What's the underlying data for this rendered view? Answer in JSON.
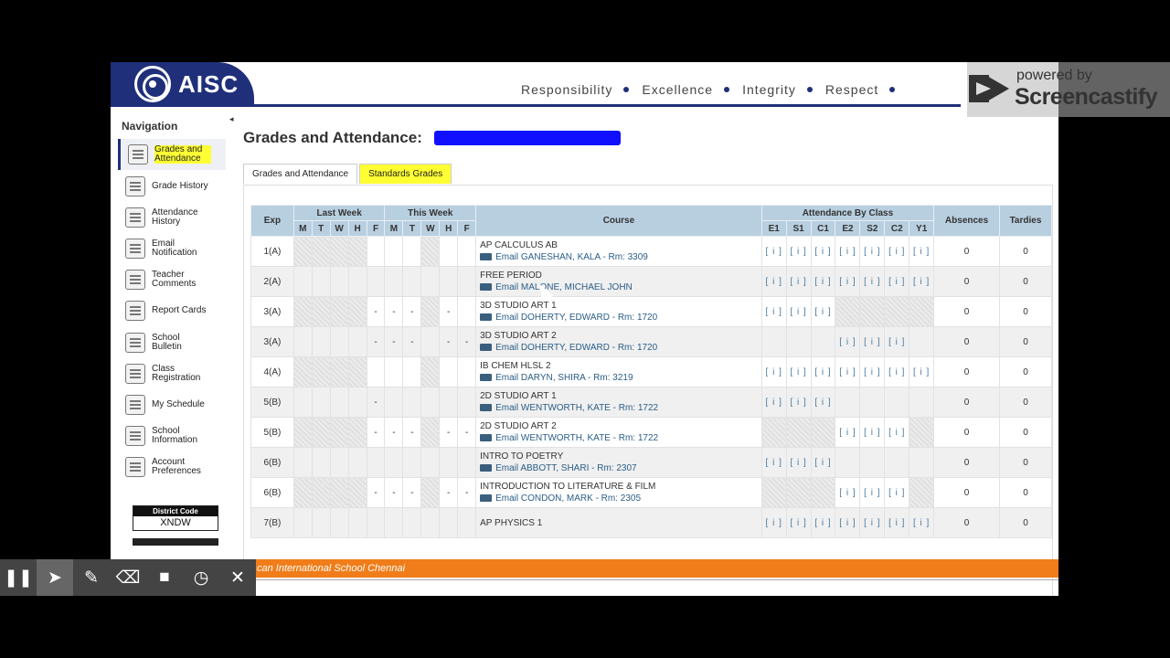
{
  "header": {
    "logo_text": "AISC",
    "values": [
      "Responsibility",
      "Excellence",
      "Integrity",
      "Respect"
    ]
  },
  "screencastify": {
    "powered": "powered by",
    "name": "Screencastify"
  },
  "sidebar": {
    "title": "Navigation",
    "items": [
      {
        "label": "Grades and Attendance",
        "icon": "gradebook-icon",
        "active": true
      },
      {
        "label": "Grade History",
        "icon": "history-icon"
      },
      {
        "label": "Attendance History",
        "icon": "attendance-icon"
      },
      {
        "label": "Email Notification",
        "icon": "envelope-icon"
      },
      {
        "label": "Teacher Comments",
        "icon": "comment-icon"
      },
      {
        "label": "Report Cards",
        "icon": "report-icon"
      },
      {
        "label": "School Bulletin",
        "icon": "bulletin-icon"
      },
      {
        "label": "Class Registration",
        "icon": "registration-icon"
      },
      {
        "label": "My Schedule",
        "icon": "schedule-icon"
      },
      {
        "label": "School Information",
        "icon": "school-icon"
      },
      {
        "label": "Account Preferences",
        "icon": "preferences-icon"
      }
    ],
    "district_label": "District Code",
    "district_code": "XNDW"
  },
  "main": {
    "title": "Grades and Attendance:",
    "tabs": [
      {
        "label": "Grades and Attendance",
        "active": true
      },
      {
        "label": "Standards Grades",
        "highlighted": true
      }
    ]
  },
  "table": {
    "caption": "Attendance By Class",
    "col_exp": "Exp",
    "last_week": "Last Week",
    "this_week": "This Week",
    "days": [
      "M",
      "T",
      "W",
      "H",
      "F"
    ],
    "col_course": "Course",
    "terms": [
      "E1",
      "S1",
      "C1",
      "E2",
      "S2",
      "C2",
      "Y1"
    ],
    "col_absences": "Absences",
    "col_tardies": "Tardies",
    "rows": [
      {
        "exp": "1(A)",
        "course": "AP CALCULUS AB",
        "teacher": "Email GANESHAN, KALA - Rm: 3309",
        "terms": [
          "[ i ]",
          "[ i ]",
          "[ i ]",
          "[ i ]",
          "[ i ]",
          "[ i ]",
          "[ i ]"
        ],
        "lw": [
          "",
          "",
          "",
          "",
          ""
        ],
        "tw": [
          "",
          "",
          "",
          "",
          ""
        ],
        "absences": "0",
        "tardies": "0"
      },
      {
        "exp": "2(A)",
        "course": "FREE PERIOD",
        "teacher": "Email MALONE, MICHAEL JOHN",
        "terms": [
          "[ i ]",
          "[ i ]",
          "[ i ]",
          "[ i ]",
          "[ i ]",
          "[ i ]",
          "[ i ]"
        ],
        "lw": [
          "",
          "",
          "",
          "",
          ""
        ],
        "tw": [
          "",
          "",
          "",
          "",
          ""
        ],
        "absences": "0",
        "tardies": "0"
      },
      {
        "exp": "3(A)",
        "course": "3D STUDIO ART 1",
        "teacher": "Email DOHERTY, EDWARD - Rm: 1720",
        "terms": [
          "[ i ]",
          "[ i ]",
          "[ i ]",
          "",
          "",
          "",
          ""
        ],
        "lw": [
          "",
          "",
          "",
          "",
          "-"
        ],
        "tw": [
          "-",
          "-",
          "",
          "-",
          ""
        ],
        "absences": "0",
        "tardies": "0"
      },
      {
        "exp": "3(A)",
        "course": "3D STUDIO ART 2",
        "teacher": "Email DOHERTY, EDWARD - Rm: 1720",
        "terms": [
          "",
          "",
          "",
          "[ i ]",
          "[ i ]",
          "[ i ]",
          ""
        ],
        "lw": [
          "",
          "",
          "",
          "",
          "-"
        ],
        "tw": [
          "-",
          "-",
          "",
          "-",
          "-"
        ],
        "absences": "0",
        "tardies": "0"
      },
      {
        "exp": "4(A)",
        "course": "IB CHEM HLSL 2",
        "teacher": "Email DARYN, SHIRA - Rm: 3219",
        "terms": [
          "[ i ]",
          "[ i ]",
          "[ i ]",
          "[ i ]",
          "[ i ]",
          "[ i ]",
          "[ i ]"
        ],
        "lw": [
          "",
          "",
          "",
          "",
          ""
        ],
        "tw": [
          "",
          "",
          "",
          "",
          ""
        ],
        "absences": "0",
        "tardies": "0"
      },
      {
        "exp": "5(B)",
        "course": "2D STUDIO ART 1",
        "teacher": "Email WENTWORTH, KATE - Rm: 1722",
        "terms": [
          "[ i ]",
          "[ i ]",
          "[ i ]",
          "",
          "",
          "",
          ""
        ],
        "lw": [
          "",
          "",
          "",
          "",
          "-"
        ],
        "tw": [
          "",
          "",
          "",
          "",
          ""
        ],
        "absences": "0",
        "tardies": "0"
      },
      {
        "exp": "5(B)",
        "course": "2D STUDIO ART 2",
        "teacher": "Email WENTWORTH, KATE - Rm: 1722",
        "terms": [
          "",
          "",
          "",
          "[ i ]",
          "[ i ]",
          "[ i ]",
          ""
        ],
        "lw": [
          "",
          "",
          "",
          "",
          "-"
        ],
        "tw": [
          "-",
          "-",
          "",
          "-",
          "-"
        ],
        "absences": "0",
        "tardies": "0"
      },
      {
        "exp": "6(B)",
        "course": "INTRO TO POETRY",
        "teacher": "Email ABBOTT, SHARI - Rm: 2307",
        "terms": [
          "[ i ]",
          "[ i ]",
          "[ i ]",
          "",
          "",
          "",
          ""
        ],
        "lw": [
          "",
          "",
          "",
          "",
          ""
        ],
        "tw": [
          "",
          "",
          "",
          "",
          ""
        ],
        "absences": "0",
        "tardies": "0"
      },
      {
        "exp": "6(B)",
        "course": "INTRODUCTION TO LITERATURE & FILM",
        "teacher": "Email CONDON, MARK - Rm: 2305",
        "terms": [
          "",
          "",
          "",
          "[ i ]",
          "[ i ]",
          "[ i ]",
          ""
        ],
        "lw": [
          "",
          "",
          "",
          "",
          "-"
        ],
        "tw": [
          "-",
          "-",
          "",
          "-",
          "-"
        ],
        "absences": "0",
        "tardies": "0"
      },
      {
        "exp": "7(B)",
        "course": "AP PHYSICS 1",
        "teacher": "",
        "terms": [
          "[ i ]",
          "[ i ]",
          "[ i ]",
          "[ i ]",
          "[ i ]",
          "[ i ]",
          "[ i ]"
        ],
        "lw": [
          "",
          "",
          "",
          "",
          ""
        ],
        "tw": [
          "",
          "",
          "",
          "",
          ""
        ],
        "absences": "0",
        "tardies": "0"
      }
    ]
  },
  "footer": {
    "text": "can International School Chennai"
  },
  "colors": {
    "navy": "#1f2f7a",
    "orange": "#f07d1a",
    "table_header": "#b8cfe0",
    "redaction": "#1010ff"
  },
  "recorder": {
    "buttons": [
      {
        "name": "pause-icon",
        "glyph": "❚❚"
      },
      {
        "name": "cursor-icon",
        "glyph": "➤"
      },
      {
        "name": "pen-icon",
        "glyph": "✎"
      },
      {
        "name": "eraser-icon",
        "glyph": "⌫"
      },
      {
        "name": "camera-icon",
        "glyph": "■"
      },
      {
        "name": "timer-icon",
        "glyph": "◷"
      },
      {
        "name": "close-icon",
        "glyph": "✕"
      }
    ]
  }
}
